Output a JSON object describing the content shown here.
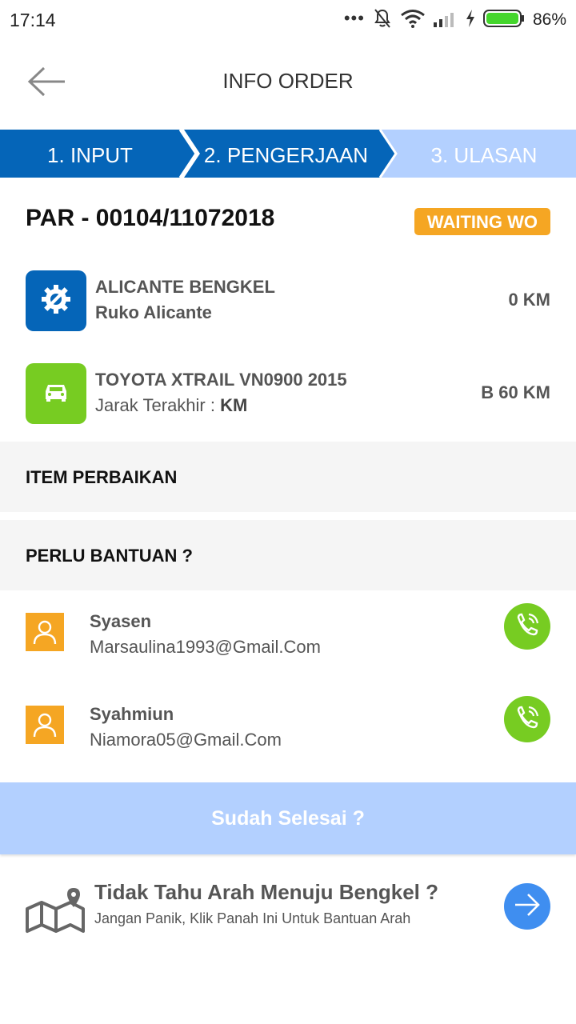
{
  "status_bar": {
    "time": "17:14",
    "battery": "86%",
    "icons": [
      "dots-icon",
      "bell-off-icon",
      "wifi-icon",
      "signal-icon",
      "charging-icon",
      "battery-icon"
    ]
  },
  "header": {
    "title": "INFO ORDER",
    "back_icon": "back-arrow-icon"
  },
  "stepper": {
    "steps": [
      {
        "label": "1. INPUT",
        "state": "done"
      },
      {
        "label": "2. PENGERJAAN",
        "state": "active"
      },
      {
        "label": "3. ULASAN",
        "state": "pending"
      }
    ],
    "colors": {
      "active": "#0565b8",
      "pending": "#b3d0ff"
    }
  },
  "order": {
    "number": "PAR - 00104/11072018",
    "status": "WAITING WO",
    "status_color": "#f5a623"
  },
  "workshop": {
    "icon": "gear-wrench-icon",
    "name": "ALICANTE BENGKEL",
    "address": "Ruko Alicante",
    "distance": "0 KM",
    "color": "#0565b8"
  },
  "vehicle": {
    "icon": "car-icon",
    "name": "TOYOTA XTRAIL VN0900 2015",
    "last_distance_label": "Jarak Terakhir : ",
    "last_distance_value": "KM",
    "plate_distance": "B 60 KM",
    "color": "#77cc22"
  },
  "sections": {
    "repair_items": "ITEM PERBAIKAN",
    "need_help": "PERLU BANTUAN ?"
  },
  "contacts": [
    {
      "name": "Syasen",
      "email": "Marsaulina1993@Gmail.Com",
      "icon": "user-icon",
      "action_icon": "phone-icon"
    },
    {
      "name": "Syahmiun",
      "email": "Niamora05@Gmail.Com",
      "icon": "user-icon",
      "action_icon": "phone-icon"
    }
  ],
  "done_button": "Sudah Selesai ?",
  "directions": {
    "icon": "map-pin-icon",
    "title": "Tidak Tahu Arah Menuju Bengkel ?",
    "subtitle": "Jangan Panik, Klik Panah Ini Untuk Bantuan Arah",
    "action_icon": "arrow-right-icon"
  }
}
